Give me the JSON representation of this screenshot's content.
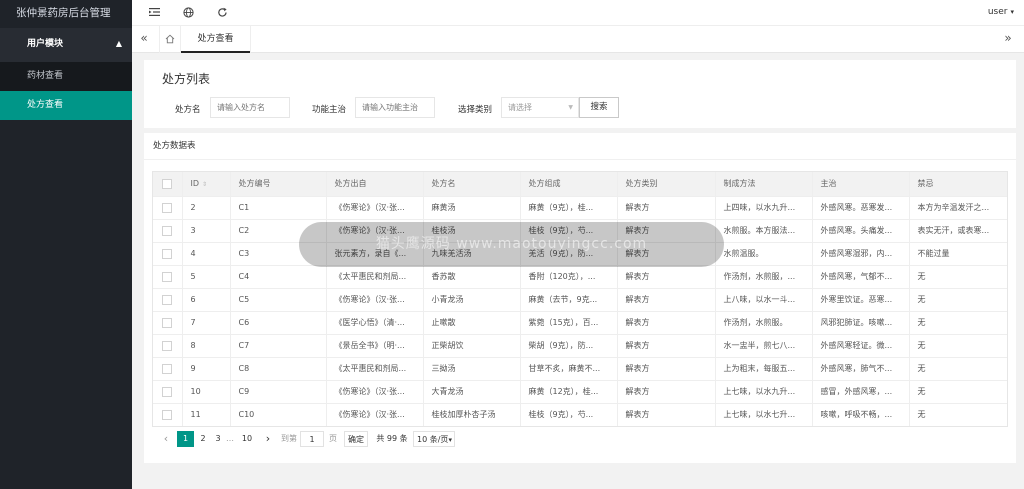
{
  "app": {
    "title": "张仲景药房后台管理"
  },
  "sidebar": {
    "group": {
      "label": "用户模块"
    },
    "items": [
      {
        "label": "药材查看"
      },
      {
        "label": "处方查看"
      }
    ]
  },
  "header": {
    "icons": [
      "menu-fold-icon",
      "globe-icon",
      "refresh-icon"
    ],
    "user": "user"
  },
  "tabs": {
    "active_tab": "处方查看"
  },
  "page": {
    "title": "处方列表",
    "filters": {
      "name_label": "处方名",
      "name_placeholder": "请输入处方名",
      "func_label": "功能主治",
      "func_placeholder": "请输入功能主治",
      "type_label": "选择类别",
      "type_placeholder": "请选择",
      "search_button": "搜索"
    }
  },
  "table": {
    "title": "处方数据表",
    "columns": [
      "ID",
      "处方编号",
      "处方出自",
      "处方名",
      "处方组成",
      "处方类别",
      "制成方法",
      "主治",
      "禁忌"
    ],
    "rows": [
      [
        "2",
        "C1",
        "《伤寒论》（汉·张...",
        "麻黄汤",
        "麻黄（9克），桂...",
        "解表方",
        "上四味，以水九升...",
        "外感风寒。恶寒发...",
        "本方为辛温发汗之..."
      ],
      [
        "3",
        "C2",
        "《伤寒论》（汉·张...",
        "桂枝汤",
        "桂枝（9克），芍...",
        "解表方",
        "水煎服。本方服法...",
        "外感风寒。头痛发...",
        "表实无汗，或表寒..."
      ],
      [
        "4",
        "C3",
        "张元素方，录自《...",
        "九味羌活汤",
        "羌活（9克），防...",
        "解表方",
        "水煎温服。",
        "外感风寒湿邪，内...",
        "不能过量"
      ],
      [
        "5",
        "C4",
        "《太平惠民和剂局...",
        "香苏散",
        "香附（120克），...",
        "解表方",
        "作汤剂，水煎服，...",
        "外感风寒，气郁不...",
        "无"
      ],
      [
        "6",
        "C5",
        "《伤寒论》（汉·张...",
        "小青龙汤",
        "麻黄（去节，9克...",
        "解表方",
        "上八味，以水一斗...",
        "外寒里饮证。恶寒...",
        "无"
      ],
      [
        "7",
        "C6",
        "《医学心悟》（清·...",
        "止嗽散",
        "紫菀（15克），百...",
        "解表方",
        "作汤剂，水煎服。",
        "风邪犯肺证。咳嗽...",
        "无"
      ],
      [
        "8",
        "C7",
        "《景岳全书》（明·...",
        "正柴胡饮",
        "柴胡（9克），防...",
        "解表方",
        "水一盅半，煎七八...",
        "外感风寒轻证。微...",
        "无"
      ],
      [
        "9",
        "C8",
        "《太平惠民和剂局...",
        "三拗汤",
        "甘草不炙，麻黄不...",
        "解表方",
        "上为粗末，每服五...",
        "外感风寒，肺气不...",
        "无"
      ],
      [
        "10",
        "C9",
        "《伤寒论》（汉·张...",
        "大青龙汤",
        "麻黄（12克），桂...",
        "解表方",
        "上七味，以水九升...",
        "感冒，外感风寒，...",
        "无"
      ],
      [
        "11",
        "C10",
        "《伤寒论》（汉·张...",
        "桂枝加厚朴杏子汤",
        "桂枝（9克），芍...",
        "解表方",
        "上七味，以水七升...",
        "咳嗽，呼吸不畅，...",
        "无"
      ]
    ]
  },
  "pager": {
    "prev": "‹",
    "pages": [
      "1",
      "2",
      "3"
    ],
    "ellipsis": "…",
    "last": "10",
    "next": "›",
    "goto_label": "到第",
    "goto_value": "1",
    "page_unit": "页",
    "confirm": "确定",
    "total": "共 99 条",
    "per_page": "10 条/页"
  },
  "overlay": {
    "watermark": "猫头鹰源码 www.maotouyingcc.com"
  },
  "colors": {
    "accent": "#009688",
    "sidebar_bg": "#1f2329"
  }
}
